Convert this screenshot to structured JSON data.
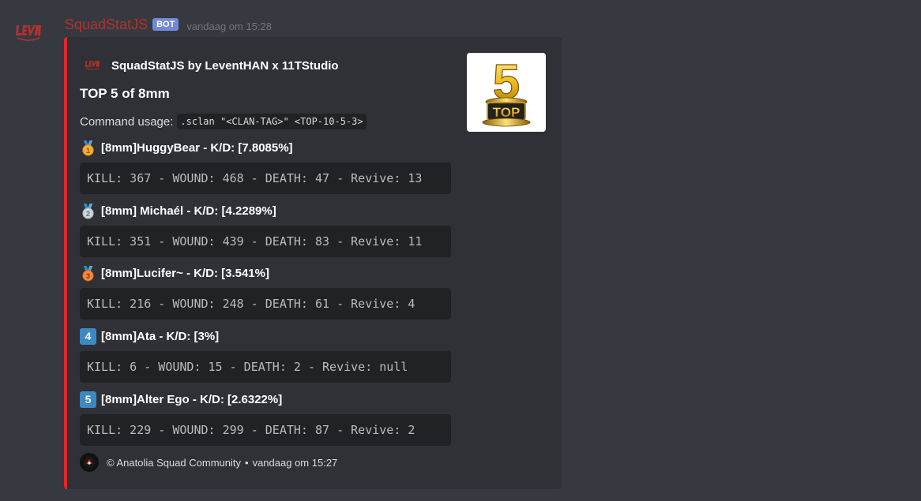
{
  "message": {
    "username": "SquadStatJS",
    "bot_tag": "BOT",
    "timestamp": "vandaag om 15:28",
    "avatar_icon": "leven-logo-icon"
  },
  "embed": {
    "accent_color": "#e0272d",
    "author": {
      "name": "SquadStatJS by LeventHAN x 11TStudio",
      "icon": "leven-logo-icon"
    },
    "thumbnail": {
      "icon": "top5-trophy-icon",
      "number": "5",
      "label": "TOP"
    },
    "title": "TOP 5 of 8mm",
    "usage_label": "Command usage:",
    "usage_code": ".sclan \"<CLAN-TAG>\" <TOP-10-5-3>",
    "fields": [
      {
        "rank_icon": "gold-medal-icon",
        "name": "[8mm]HuggyBear - K/D: [7.8085%]",
        "value": "KILL: 367 - WOUND: 468 - DEATH: 47 - Revive: 13"
      },
      {
        "rank_icon": "silver-medal-icon",
        "name": "[8mm] Michaél - K/D: [4.2289%]",
        "value": "KILL: 351 - WOUND: 439 - DEATH: 83 - Revive: 11"
      },
      {
        "rank_icon": "bronze-medal-icon",
        "name": "[8mm]Lucifer~ - K/D: [3.541%]",
        "value": "KILL: 216 - WOUND: 248 - DEATH: 61 - Revive: 4"
      },
      {
        "rank_icon": "keycap-4-icon",
        "rank_label": "4",
        "name": "[8mm]Ata - K/D: [3%]",
        "value": "KILL: 6 - WOUND: 15 - DEATH: 2 - Revive: null"
      },
      {
        "rank_icon": "keycap-5-icon",
        "rank_label": "5",
        "name": "[8mm]Alter Ego - K/D: [2.6322%]",
        "value": "KILL: 229 - WOUND: 299 - DEATH: 87 - Revive: 2"
      }
    ],
    "footer": {
      "icon": "anatolia-logo-icon",
      "text": "© Anatolia Squad Community",
      "separator": "•",
      "timestamp": "vandaag om 15:27"
    }
  }
}
